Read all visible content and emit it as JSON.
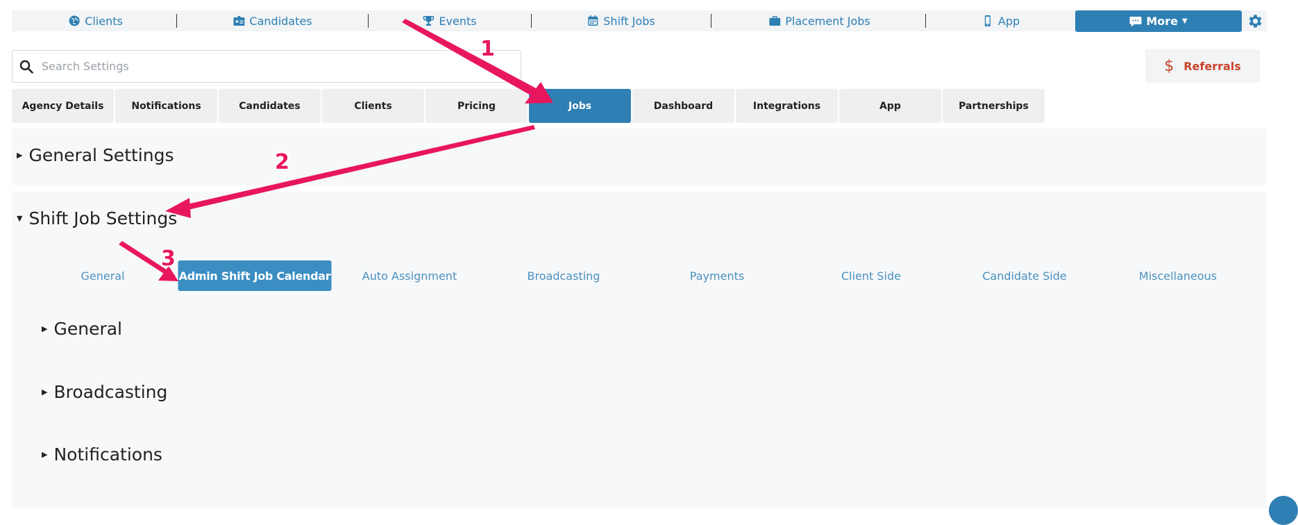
{
  "topnav": {
    "items": [
      {
        "label": "Clients",
        "icon": "globe-icon"
      },
      {
        "label": "Candidates",
        "icon": "id-card-icon"
      },
      {
        "label": "Events",
        "icon": "trophy-icon"
      },
      {
        "label": "Shift Jobs",
        "icon": "calendar-icon"
      },
      {
        "label": "Placement Jobs",
        "icon": "briefcase-icon"
      },
      {
        "label": "App",
        "icon": "mobile-phone-icon"
      }
    ],
    "more_label": "More",
    "more_icon": "chat-bubble-icon"
  },
  "search": {
    "placeholder": "Search Settings"
  },
  "referrals": {
    "symbol": "$",
    "label": "Referrals"
  },
  "tabs": {
    "items": [
      "Agency Details",
      "Notifications",
      "Candidates",
      "Clients",
      "Pricing",
      "Jobs",
      "Dashboard",
      "Integrations",
      "App",
      "Partnerships"
    ],
    "active": "Jobs"
  },
  "sections": {
    "general_settings": {
      "title": "General Settings",
      "expanded": false
    },
    "shift_job_settings": {
      "title": "Shift Job Settings",
      "expanded": true,
      "subtabs": [
        "General",
        "Admin Shift Job Calendar",
        "Auto Assignment",
        "Broadcasting",
        "Payments",
        "Client Side",
        "Candidate Side",
        "Miscellaneous"
      ],
      "active_subtab": "Admin Shift Job Calendar",
      "subsections": [
        "General",
        "Broadcasting",
        "Notifications"
      ]
    }
  },
  "annotations": {
    "steps": [
      "1",
      "2",
      "3"
    ],
    "color": "#e8175d"
  },
  "colors": {
    "primary": "#2e7fb3",
    "accent": "#c9442c",
    "panel": "#f7f8f9"
  }
}
